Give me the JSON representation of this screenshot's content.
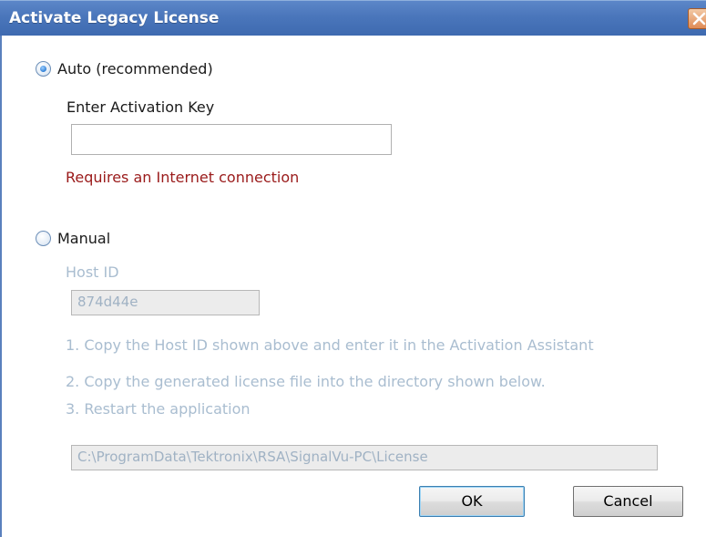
{
  "window": {
    "title": "Activate Legacy License"
  },
  "auto": {
    "label": "Auto (recommended)",
    "selected": true,
    "key_label": "Enter Activation Key",
    "key_value": "",
    "warning": "Requires an Internet connection"
  },
  "manual": {
    "label": "Manual",
    "selected": false,
    "host_id_label": "Host ID",
    "host_id_value": "874d44e",
    "step1": "1. Copy the Host ID shown above and enter it in the Activation Assistant",
    "step2": "2. Copy the generated license file into the directory shown below.",
    "step3": "3. Restart the application",
    "path": "C:\\ProgramData\\Tektronix\\RSA\\SignalVu-PC\\License"
  },
  "buttons": {
    "ok": "OK",
    "cancel": "Cancel"
  },
  "colors": {
    "title_bar": "#4a76bb",
    "warning_text": "#9a1a1a",
    "disabled_text": "#a9bdd0"
  }
}
